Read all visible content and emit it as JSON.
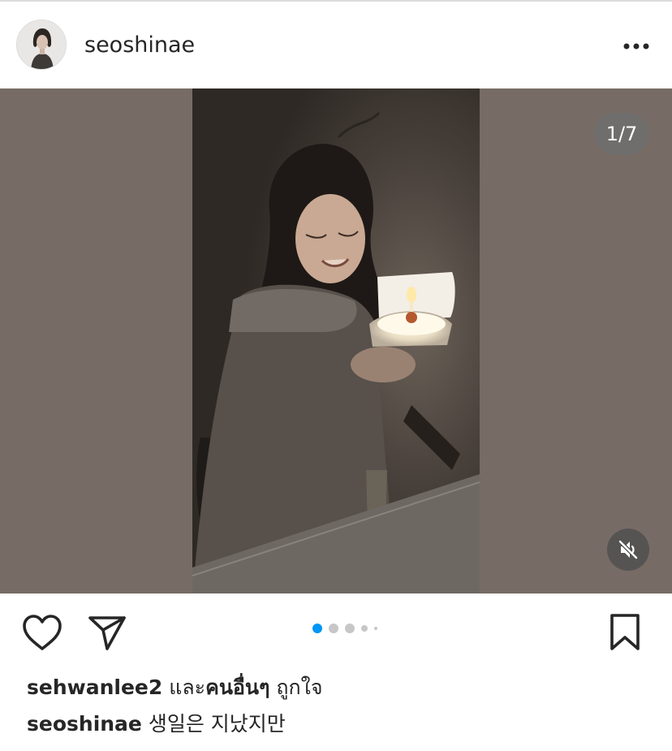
{
  "post": {
    "username": "seoshinae",
    "more_icon": "more-horizontal-icon",
    "media": {
      "counter": "1/7",
      "current_slide": 1,
      "total_slides": 7,
      "mute_icon": "speaker-muted-icon",
      "background_color": "#776b65"
    },
    "actions": {
      "like_icon": "heart-icon",
      "share_icon": "send-icon",
      "save_icon": "bookmark-icon",
      "carousel_dots_visible": 5,
      "active_dot": 1,
      "active_dot_color": "#0095f6"
    },
    "likes": {
      "user": "sehwanlee2",
      "and": " และ",
      "others": "คนอื่นๆ",
      "liked": " ถูกใจ"
    },
    "caption": {
      "author": "seoshinae",
      "text": " 생일은 지났지만"
    }
  }
}
